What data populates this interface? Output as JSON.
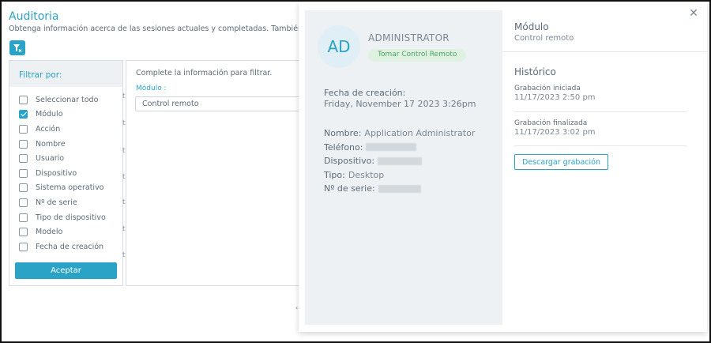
{
  "page": {
    "title": "Auditoria",
    "subtitle": "Obtenga información acerca de las sesiones actuales y completadas. También puede c"
  },
  "filter_panel": {
    "header": "Filtrar por:",
    "options": [
      {
        "label": "Seleccionar todo",
        "checked": false
      },
      {
        "label": "Módulo",
        "checked": true
      },
      {
        "label": "Acción",
        "checked": false
      },
      {
        "label": "Nombre",
        "checked": false
      },
      {
        "label": "Usuario",
        "checked": false
      },
      {
        "label": "Dispositivo",
        "checked": false
      },
      {
        "label": "Sistema operativo",
        "checked": false
      },
      {
        "label": "Nº de serie",
        "checked": false
      },
      {
        "label": "Tipo de dispositivo",
        "checked": false
      },
      {
        "label": "Modelo",
        "checked": false
      },
      {
        "label": "Fecha de creación",
        "checked": false
      }
    ],
    "accept_label": "Aceptar"
  },
  "filter_form": {
    "hint": "Complete la información para filtrar.",
    "module_label": "Módulo :",
    "module_value": "Control remoto"
  },
  "gutter_letter": "t",
  "detail": {
    "avatar_initials": "AD",
    "user_name": "ADMINISTRATOR",
    "tag": "Tomar Control Remoto",
    "created_label": "Fecha de creación:",
    "created_value": "Friday, November 17 2023 3:26pm",
    "fields": [
      {
        "label": "Nombre:",
        "value": "Application Administrator",
        "redacted": false
      },
      {
        "label": "Teléfono:",
        "value": "",
        "redacted": true
      },
      {
        "label": "Dispositivo:",
        "value": "",
        "redacted": true
      },
      {
        "label": "Tipo:",
        "value": "Desktop",
        "redacted": false
      },
      {
        "label": "Nº de serie:",
        "value": "",
        "redacted": true
      }
    ],
    "module_label": "Módulo",
    "module_value": "Control remoto",
    "history_title": "Histórico",
    "history": [
      {
        "label": "Grabación iniciada",
        "date": "11/17/2023 2:50 pm"
      },
      {
        "label": "Grabación finalizada",
        "date": "11/17/2023 3:02 pm"
      }
    ],
    "download_label": "Descargar grabación",
    "close_icon": "close-icon"
  },
  "colors": {
    "accent": "#2aa3c6",
    "tag_bg": "#dff1e1",
    "tag_text": "#4aa564"
  }
}
